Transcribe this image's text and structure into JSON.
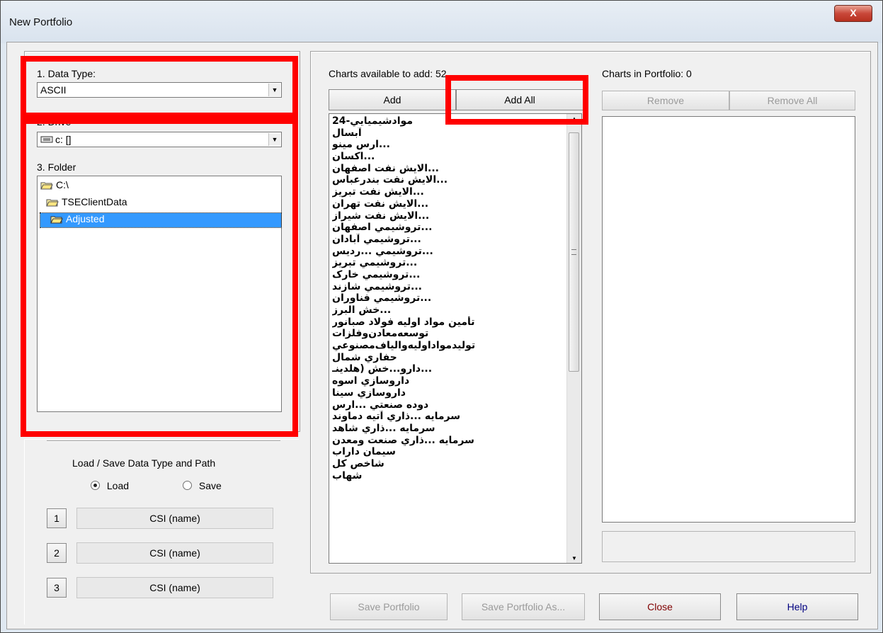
{
  "window": {
    "title": "New Portfolio",
    "close_glyph": "X"
  },
  "left": {
    "data_type_label": "1. Data Type:",
    "data_type_value": "ASCII",
    "drive_label": "2. Drive",
    "drive_value": "c: []",
    "folder_label": "3. Folder",
    "folders": [
      "C:\\",
      "TSEClientData",
      "Adjusted"
    ],
    "load_save_label": "Load / Save Data Type and Path",
    "load_label": "Load",
    "save_label": "Save",
    "presets": [
      {
        "num": "1",
        "name": "CSI (name)"
      },
      {
        "num": "2",
        "name": "CSI (name)"
      },
      {
        "num": "3",
        "name": "CSI (name)"
      }
    ]
  },
  "available": {
    "header": "Charts available to add: 52",
    "add_label": "Add",
    "add_all_label": "Add All",
    "items": [
      "موادشيميايي-24",
      "آبسال",
      "...ارس مينو",
      "...اکسان",
      "...الايش نفت اصفهان",
      "...الايش نفت بندرعباس",
      "...الايش نفت تبريز",
      "...الايش نفت تهران",
      "...الايش نفت شيراز",
      "...تروشيمي اصفهان",
      "...تروشيمي آبادان",
      "...تروشيمي ...رديس",
      "...تروشيمي تبريز",
      "...تروشيمي خارک",
      "...تروشيمي شازند",
      "...تروشيمي فناوران",
      "...خش البرز",
      "تأمين مواد اوليه فولاد صبانور",
      "توسعه‌معادن‌وفلزات",
      "توليدمواداوليه‌والياف‌مصنوعي",
      "حفاري شمال",
      "...دارو...خش (هلدينـ",
      "داروسازي اسوه",
      "داروسازي سينا",
      "دوده صنعتي ...ارس",
      "سرمايه ...ذاري آتيه دماوند",
      "سرمايه ...ذاري شاهد",
      "سرمايه ...ذاري صنعت ومعدن",
      "سيمان داراب",
      "شاخص کل",
      "شهاب"
    ]
  },
  "portfolio": {
    "header": "Charts in Portfolio: 0",
    "remove_label": "Remove",
    "remove_all_label": "Remove All"
  },
  "footer": {
    "save_label": "Save Portfolio",
    "save_as_label": "Save Portfolio As...",
    "close_label": "Close",
    "help_label": "Help"
  },
  "colors": {
    "highlight": "#3399ff",
    "annotation": "#ff0000",
    "close_text": "#800000",
    "help_text": "#000080"
  }
}
